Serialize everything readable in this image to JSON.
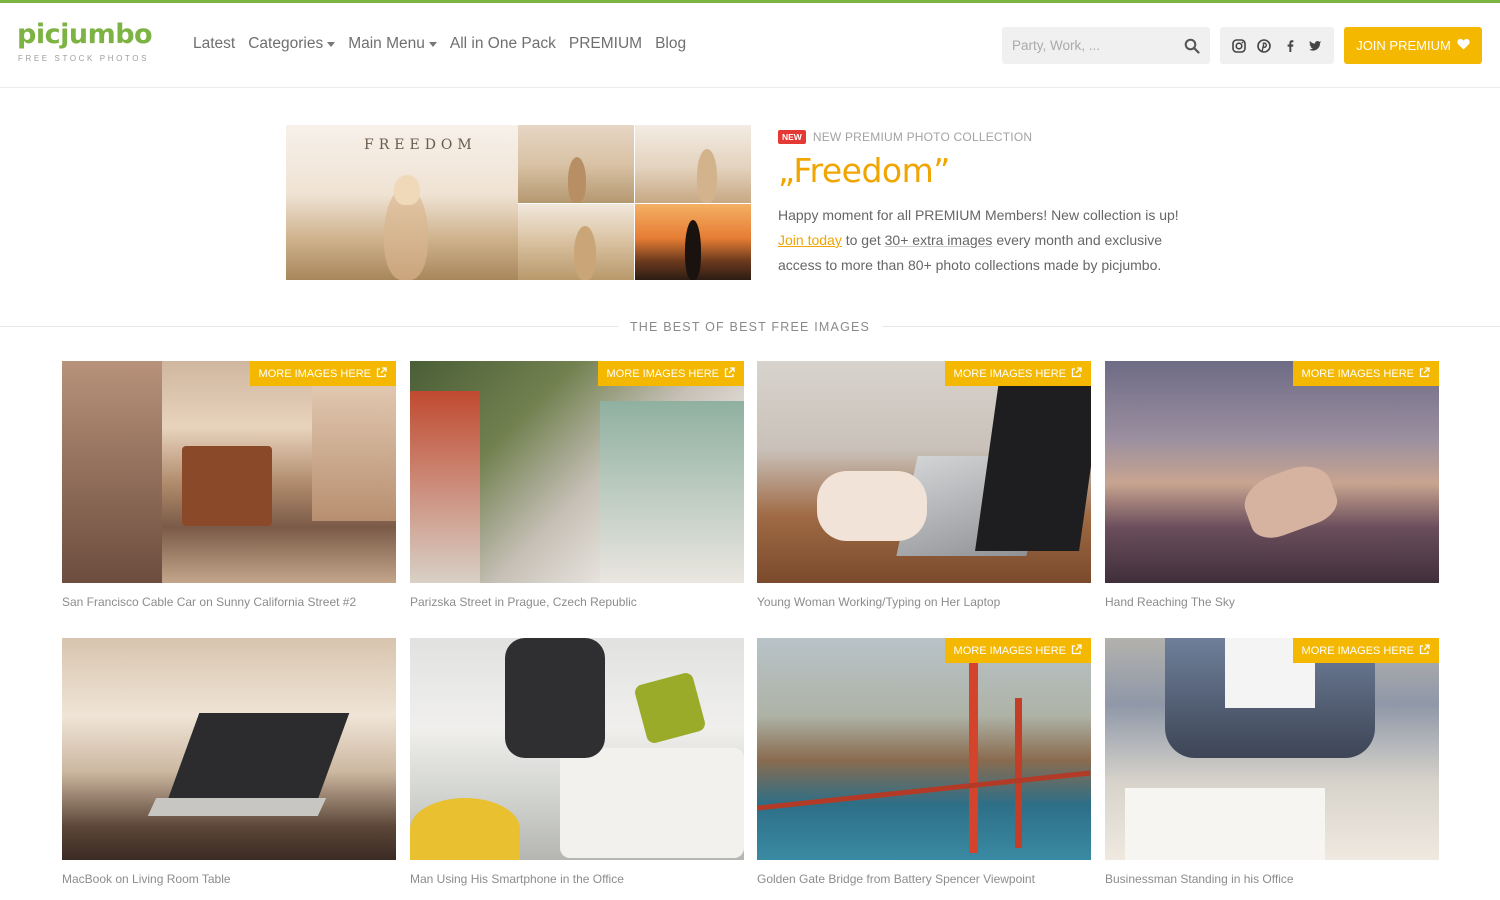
{
  "brand": {
    "name": "picjumbo",
    "tagline": "FREE STOCK PHOTOS",
    "accent_green": "#7cb342",
    "accent_yellow": "#f5b800"
  },
  "nav": {
    "items": [
      {
        "label": "Latest",
        "dropdown": false
      },
      {
        "label": "Categories",
        "dropdown": true
      },
      {
        "label": "Main Menu",
        "dropdown": true
      },
      {
        "label": "All in One Pack",
        "dropdown": false
      },
      {
        "label": "PREMIUM",
        "dropdown": false
      },
      {
        "label": "Blog",
        "dropdown": false
      }
    ]
  },
  "search": {
    "placeholder": "Party, Work, ...",
    "value": "",
    "icon": "search-icon"
  },
  "social": {
    "icons": [
      "instagram-icon",
      "pinterest-icon",
      "facebook-icon",
      "twitter-icon"
    ]
  },
  "join": {
    "label": "JOIN PREMIUM",
    "icon": "heart-icon"
  },
  "promo": {
    "badge": "NEW",
    "kicker": "NEW PREMIUM PHOTO COLLECTION",
    "title": "„Freedom”",
    "image_word": "FREEDOM",
    "line1": "Happy moment for all PREMIUM Members! New collection is up!",
    "join_link": "Join today",
    "line2_a": " to get ",
    "line2_b": "30+ extra images",
    "line2_c": " every month and exclusive",
    "line3": "access to more than 80+ photo collections made by picjumbo."
  },
  "section": {
    "title": "THE BEST OF BEST FREE IMAGES"
  },
  "more_label": "MORE IMAGES HERE",
  "photos": [
    {
      "caption": "San Francisco Cable Car on Sunny California Street #2",
      "has_more": true
    },
    {
      "caption": "Parizska Street in Prague, Czech Republic",
      "has_more": true
    },
    {
      "caption": "Young Woman Working/Typing on Her Laptop",
      "has_more": true
    },
    {
      "caption": "Hand Reaching The Sky",
      "has_more": true
    },
    {
      "caption": "MacBook on Living Room Table",
      "has_more": false
    },
    {
      "caption": "Man Using His Smartphone in the Office",
      "has_more": false
    },
    {
      "caption": "Golden Gate Bridge from Battery Spencer Viewpoint",
      "has_more": true
    },
    {
      "caption": "Businessman Standing in his Office",
      "has_more": true
    }
  ]
}
